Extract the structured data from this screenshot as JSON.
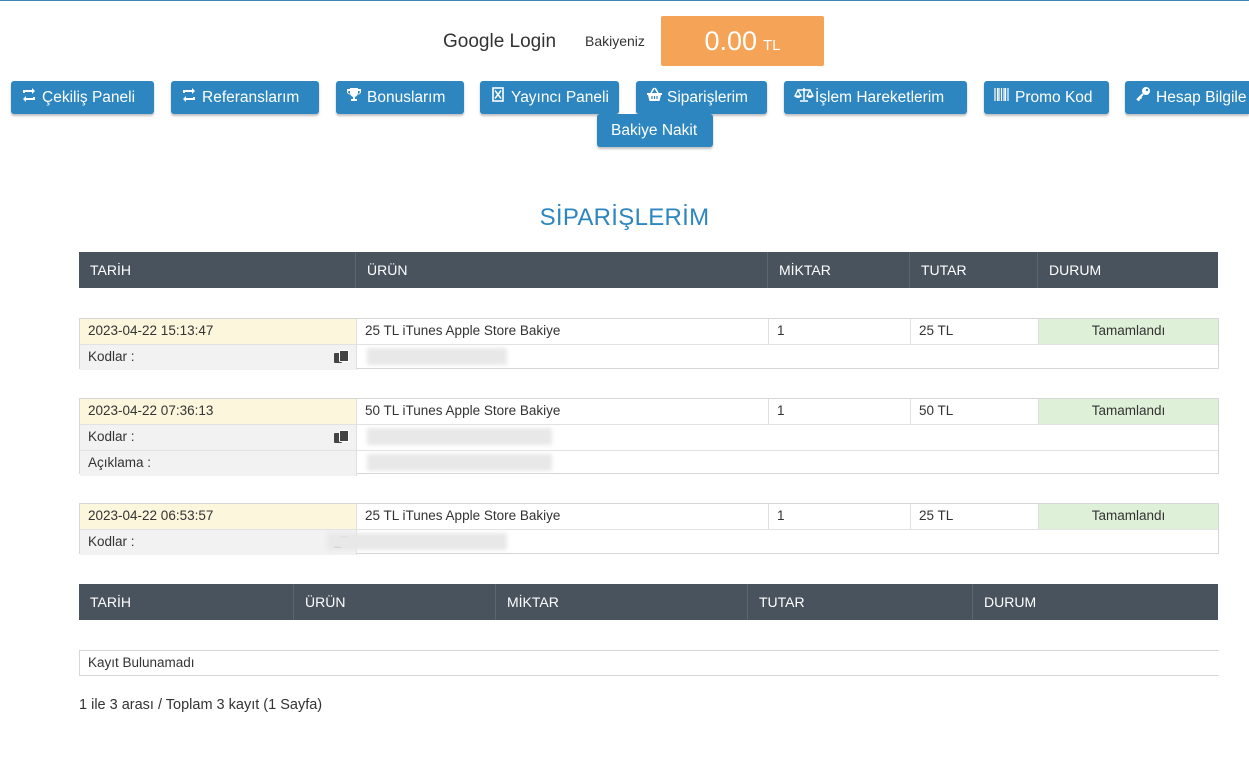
{
  "header": {
    "login_text": "Google Login",
    "balance_label": "Bakiyeniz",
    "balance_amount": "0.00",
    "balance_currency": "TL"
  },
  "nav": {
    "items": [
      {
        "label": "Çekiliş Paneli",
        "icon": "retweet-icon"
      },
      {
        "label": "Referanslarım",
        "icon": "retweet-icon"
      },
      {
        "label": "Bonuslarım",
        "icon": "trophy-icon"
      },
      {
        "label": "Yayıncı Paneli",
        "icon": "boxed-x-icon"
      },
      {
        "label": "Siparişlerim",
        "icon": "basket-icon"
      },
      {
        "label": "İşlem Hareketlerim",
        "icon": "scale-icon"
      },
      {
        "label": "Promo Kod",
        "icon": "barcode-icon"
      },
      {
        "label": "Hesap Bilgile",
        "icon": "key-icon"
      },
      {
        "label": "Bakiye Nakit",
        "icon": ""
      }
    ]
  },
  "page_title": "SİPARİŞLERİM",
  "orders_table": {
    "headers": [
      "TARİH",
      "ÜRÜN",
      "MİKTAR",
      "TUTAR",
      "DURUM"
    ],
    "orders": [
      {
        "date": "2023-04-22 15:13:47",
        "product": "25 TL iTunes Apple Store Bakiye",
        "quantity": "1",
        "amount": "25 TL",
        "status": "Tamamlandı",
        "codes_label": "Kodlar :"
      },
      {
        "date": "2023-04-22 07:36:13",
        "product": "50 TL iTunes Apple Store Bakiye",
        "quantity": "1",
        "amount": "50 TL",
        "status": "Tamamlandı",
        "codes_label": "Kodlar :",
        "description_label": "Açıklama :"
      },
      {
        "date": "2023-04-22 06:53:57",
        "product": "25 TL iTunes Apple Store Bakiye",
        "quantity": "1",
        "amount": "25 TL",
        "status": "Tamamlandı",
        "codes_label": "Kodlar :"
      }
    ]
  },
  "second_table": {
    "headers": [
      "TARİH",
      "ÜRÜN",
      "MİKTAR",
      "TUTAR",
      "DURUM"
    ],
    "empty_text": "Kayıt Bulunamadı"
  },
  "pagination_summary": "1 ile 3 arası / Toplam 3 kayıt (1 Sayfa)",
  "colors": {
    "accent": "#2d86c0",
    "balance_bg": "#f5a356",
    "table_header_bg": "#48535d",
    "status_bg": "#dff0d8",
    "date_bg": "#fcf6dc"
  }
}
